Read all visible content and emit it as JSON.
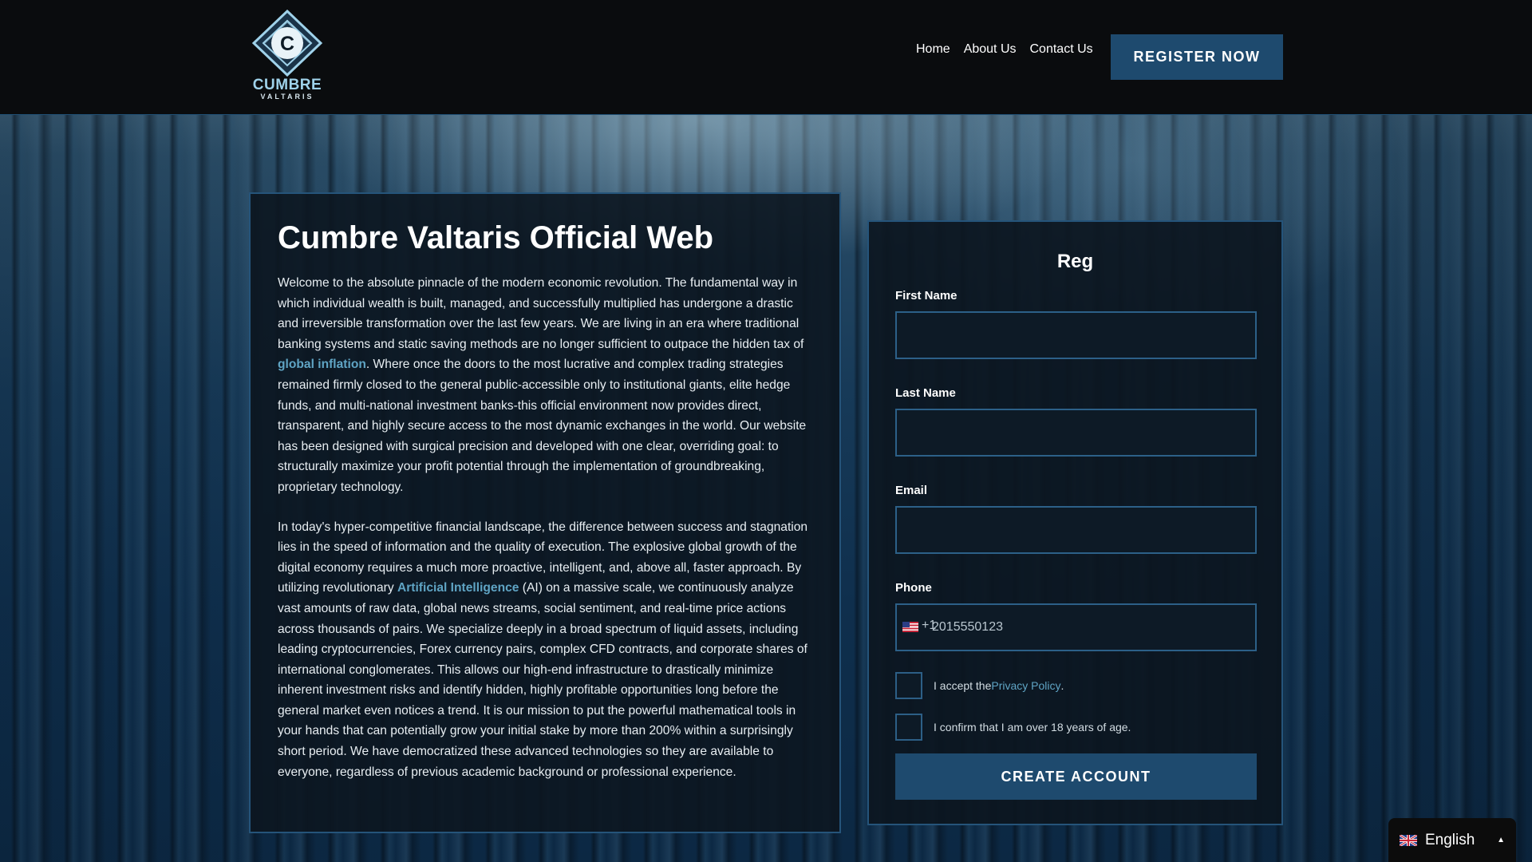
{
  "header": {
    "logo_letter": "C",
    "logo_word": "CUMBRE",
    "logo_sub": "VALTARIS",
    "nav": [
      "Home",
      "About Us",
      "Contact Us"
    ],
    "register_label": "REGISTER NOW"
  },
  "info": {
    "title": "Cumbre Valtaris Official Web",
    "p1_a": "Welcome to the absolute pinnacle of the modern economic revolution. The fundamental way in which individual wealth is built, managed, and successfully multiplied has undergone a drastic and irreversible transformation over the last few years. We are living in an era where traditional banking systems and static saving methods are no longer sufficient to outpace the hidden tax of ",
    "p1_link": "global inflation",
    "p1_b": ". Where once the doors to the most lucrative and complex trading strategies remained firmly closed to the general public-accessible only to institutional giants, elite hedge funds, and multi-national investment banks-this official environment now provides direct, transparent, and highly secure access to the most dynamic exchanges in the world. Our website has been designed with surgical precision and developed with one clear, overriding goal: to structurally maximize your profit potential through the implementation of groundbreaking, proprietary technology.",
    "p2_a": "In today's hyper-competitive financial landscape, the difference between success and stagnation lies in the speed of information and the quality of execution. The explosive global growth of the digital economy requires a much more proactive, intelligent, and, above all, faster approach. By utilizing revolutionary ",
    "p2_link": "Artificial Intelligence",
    "p2_b": " (AI) on a massive scale, we continuously analyze vast amounts of raw data, global news streams, social sentiment, and real-time price actions across thousands of pairs. We specialize deeply in a broad spectrum of liquid assets, including leading cryptocurrencies, Forex currency pairs, complex CFD contracts, and corporate shares of international conglomerates. This allows our high-end infrastructure to drastically minimize inherent investment risks and identify hidden, highly profitable opportunities long before the general market even notices a trend. It is our mission to put the powerful mathematical tools in your hands that can potentially grow your initial stake by more than 200% within a surprisingly short period. We have democratized these advanced technologies so they are available to everyone, regardless of previous academic background or professional experience."
  },
  "form": {
    "title": "Reg",
    "first_name_label": "First Name",
    "first_name_value": "",
    "last_name_label": "Last Name",
    "last_name_value": "",
    "email_label": "Email",
    "email_value": "",
    "phone_label": "Phone",
    "phone_dial_code": "+1",
    "phone_placeholder": "2015550123",
    "privacy_prefix": "I accept the ",
    "privacy_link": "Privacy Policy",
    "privacy_suffix": ".",
    "age_confirm": "I confirm that I am over 18 years of age.",
    "submit_label": "CREATE ACCOUNT"
  },
  "language": {
    "selected": "English",
    "caret": "▲"
  },
  "colors": {
    "accent": "#1e4a6e",
    "link": "#5fa4c4",
    "border": "#25547a"
  }
}
